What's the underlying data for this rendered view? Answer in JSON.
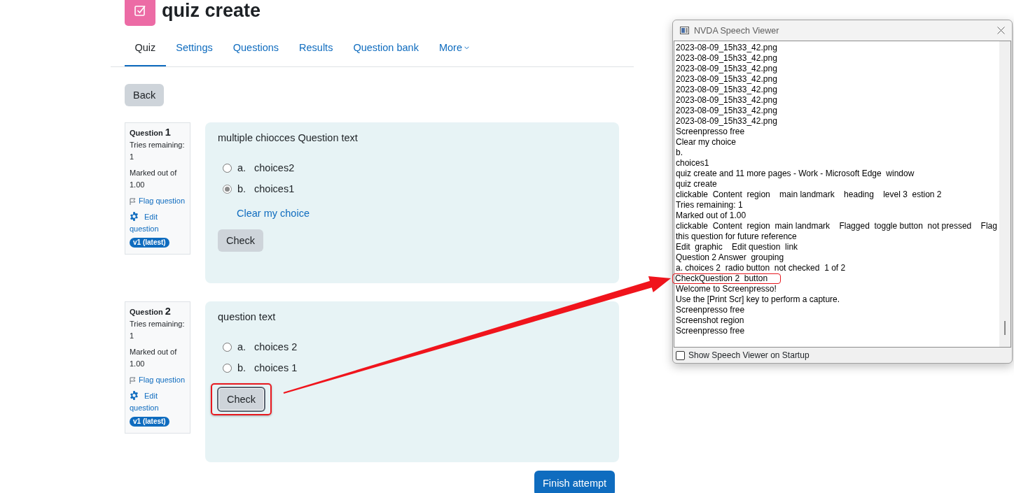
{
  "page": {
    "title": "quiz create",
    "tabs": [
      {
        "label": "Quiz",
        "selected": true,
        "kind": "link"
      },
      {
        "label": "Settings",
        "selected": false,
        "kind": "link"
      },
      {
        "label": "Questions",
        "selected": false,
        "kind": "link"
      },
      {
        "label": "Results",
        "selected": false,
        "kind": "link"
      },
      {
        "label": "Question bank",
        "selected": false,
        "kind": "link"
      },
      {
        "label": "More",
        "selected": false,
        "kind": "dropdown"
      }
    ],
    "back_button": "Back",
    "questions": [
      {
        "label": "Question",
        "number": "1",
        "tries": "Tries remaining: 1",
        "marked": "Marked out of 1.00",
        "flag": "Flag question",
        "edit": "Edit question",
        "version": "v1 (latest)",
        "text": "multiple chiocces Question text",
        "choices": [
          {
            "letter": "a.",
            "label": "choices2",
            "selected": false
          },
          {
            "letter": "b.",
            "label": "choices1",
            "selected": true
          }
        ],
        "clear_choice": "Clear my choice",
        "check_button": {
          "label": "Check",
          "focused": false
        }
      },
      {
        "label": "Question",
        "number": "2",
        "tries": "Tries remaining: 1",
        "marked": "Marked out of 1.00",
        "flag": "Flag question",
        "edit": "Edit question",
        "version": "v1 (latest)",
        "text": "question text",
        "choices": [
          {
            "letter": "a.",
            "label": "choices 2",
            "selected": false
          },
          {
            "letter": "b.",
            "label": "choices 1",
            "selected": false
          }
        ],
        "check_button": {
          "label": "Check",
          "focused": true,
          "annotated": true
        }
      }
    ],
    "finish_button": "Finish attempt"
  },
  "speech_viewer": {
    "title": "NVDA Speech Viewer",
    "lines": [
      {
        "text": "2023-08-09_15h33_42.png",
        "annotated": false
      },
      {
        "text": "2023-08-09_15h33_42.png",
        "annotated": false
      },
      {
        "text": "2023-08-09_15h33_42.png",
        "annotated": false
      },
      {
        "text": "2023-08-09_15h33_42.png",
        "annotated": false
      },
      {
        "text": "2023-08-09_15h33_42.png",
        "annotated": false
      },
      {
        "text": "2023-08-09_15h33_42.png",
        "annotated": false
      },
      {
        "text": "2023-08-09_15h33_42.png",
        "annotated": false
      },
      {
        "text": "2023-08-09_15h33_42.png",
        "annotated": false
      },
      {
        "text": "Screenpresso free",
        "annotated": false
      },
      {
        "text": "Clear my choice",
        "annotated": false
      },
      {
        "text": "b.",
        "annotated": false
      },
      {
        "text": "choices1",
        "annotated": false
      },
      {
        "text": "quiz create and 11 more pages - Work - Microsoft Edge  window",
        "annotated": false
      },
      {
        "text": "quiz create",
        "annotated": false
      },
      {
        "text": "clickable  Content  region    main landmark    heading    level 3  estion 2",
        "annotated": false
      },
      {
        "text": "Tries remaining: 1",
        "annotated": false
      },
      {
        "text": "Marked out of 1.00",
        "annotated": false
      },
      {
        "text": "clickable  Content  region  main landmark    Flagged  toggle button  not pressed    Flag this question for future reference",
        "annotated": false
      },
      {
        "text": "Edit  graphic    Edit question  link",
        "annotated": false
      },
      {
        "text": "Question 2 Answer  grouping",
        "annotated": false
      },
      {
        "text": "a. choices 2  radio button  not checked  1 of 2",
        "annotated": false
      },
      {
        "text": "CheckQuestion 2  button",
        "annotated": true
      },
      {
        "text": "Welcome to Screenpresso!",
        "annotated": false
      },
      {
        "text": "Use the [Print Scr] key to perform a capture.",
        "annotated": false
      },
      {
        "text": "Screenpresso free",
        "annotated": false
      },
      {
        "text": "Screenshot region",
        "annotated": false
      },
      {
        "text": "Screenpresso free",
        "annotated": false
      }
    ],
    "startup_checkbox": {
      "label": "Show Speech Viewer on Startup",
      "checked": false
    }
  }
}
